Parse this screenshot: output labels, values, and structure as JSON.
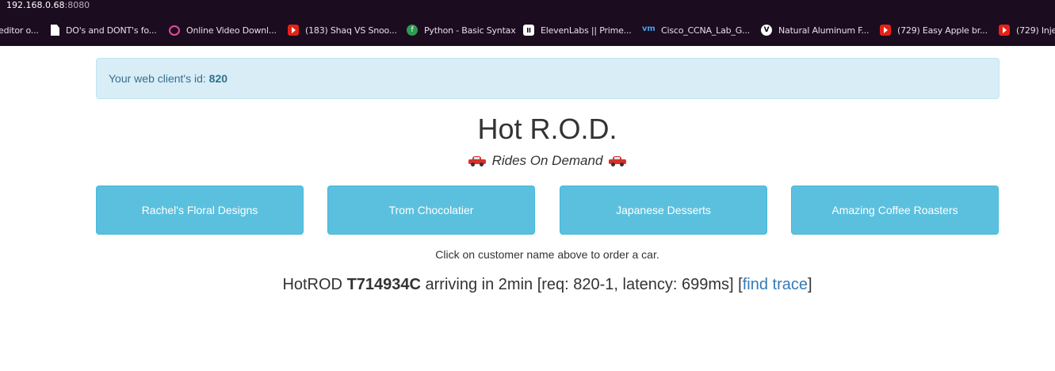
{
  "browser": {
    "url_host": "192.168.0.68",
    "url_port": ":8080",
    "bookmarks": [
      {
        "label": "editor o...",
        "icon": "none"
      },
      {
        "label": "DO's and DONT's fo...",
        "icon": "document-icon"
      },
      {
        "label": "Online Video Downl...",
        "icon": "circle-icon"
      },
      {
        "label": "(183) Shaq VS Snoo...",
        "icon": "youtube-icon"
      },
      {
        "label": "Python - Basic Syntax",
        "icon": "green-circle-icon"
      },
      {
        "label": "ElevenLabs || Prime...",
        "icon": "elevenlabs-icon"
      },
      {
        "label": "Cisco_CCNA_Lab_G...",
        "icon": "vm-icon"
      },
      {
        "label": "Natural Aluminum F...",
        "icon": "v-icon"
      },
      {
        "label": "(729) Easy Apple br...",
        "icon": "youtube-icon"
      },
      {
        "label": "(729) Inje",
        "icon": "youtube-icon"
      }
    ]
  },
  "alert": {
    "prefix": "Your web client's id: ",
    "client_id": "820"
  },
  "header": {
    "title": "Hot R.O.D.",
    "subtitle": "Rides On Demand"
  },
  "customers": [
    {
      "label": "Rachel's Floral Designs"
    },
    {
      "label": "Trom Chocolatier"
    },
    {
      "label": "Japanese Desserts"
    },
    {
      "label": "Amazing Coffee Roasters"
    }
  ],
  "hint": "Click on customer name above to order a car.",
  "result": {
    "prefix": "HotROD ",
    "car_id": "T714934C",
    "middle": " arriving in 2min [req: 820-1, latency: 699ms] [",
    "link": "find trace",
    "suffix": "]"
  },
  "colors": {
    "alert_bg": "#d9edf7",
    "alert_text": "#31708f",
    "button_bg": "#5bc0de",
    "link": "#337ab7",
    "chrome_bg": "#1c0c1f"
  }
}
